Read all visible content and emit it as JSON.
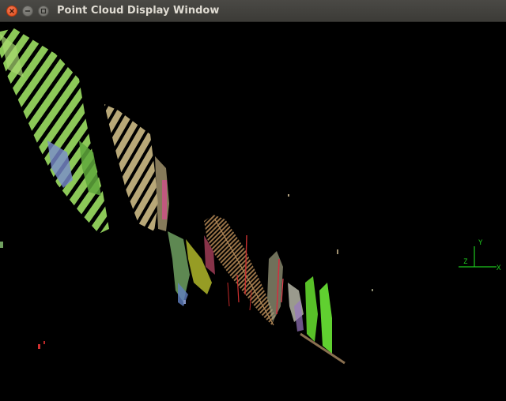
{
  "window": {
    "title": "Point Cloud Display Window"
  },
  "controls": {
    "close_icon": "close-icon",
    "minimize_icon": "minimize-icon",
    "maximize_icon": "maximize-icon"
  },
  "axes_indicator": {
    "y_label": "Y",
    "z_label": "Z",
    "x_label": "X",
    "color": "#1ec81e"
  },
  "colors": {
    "background": "#000000",
    "titlebar": "#3c3b37",
    "close_button": "#df4b16"
  }
}
